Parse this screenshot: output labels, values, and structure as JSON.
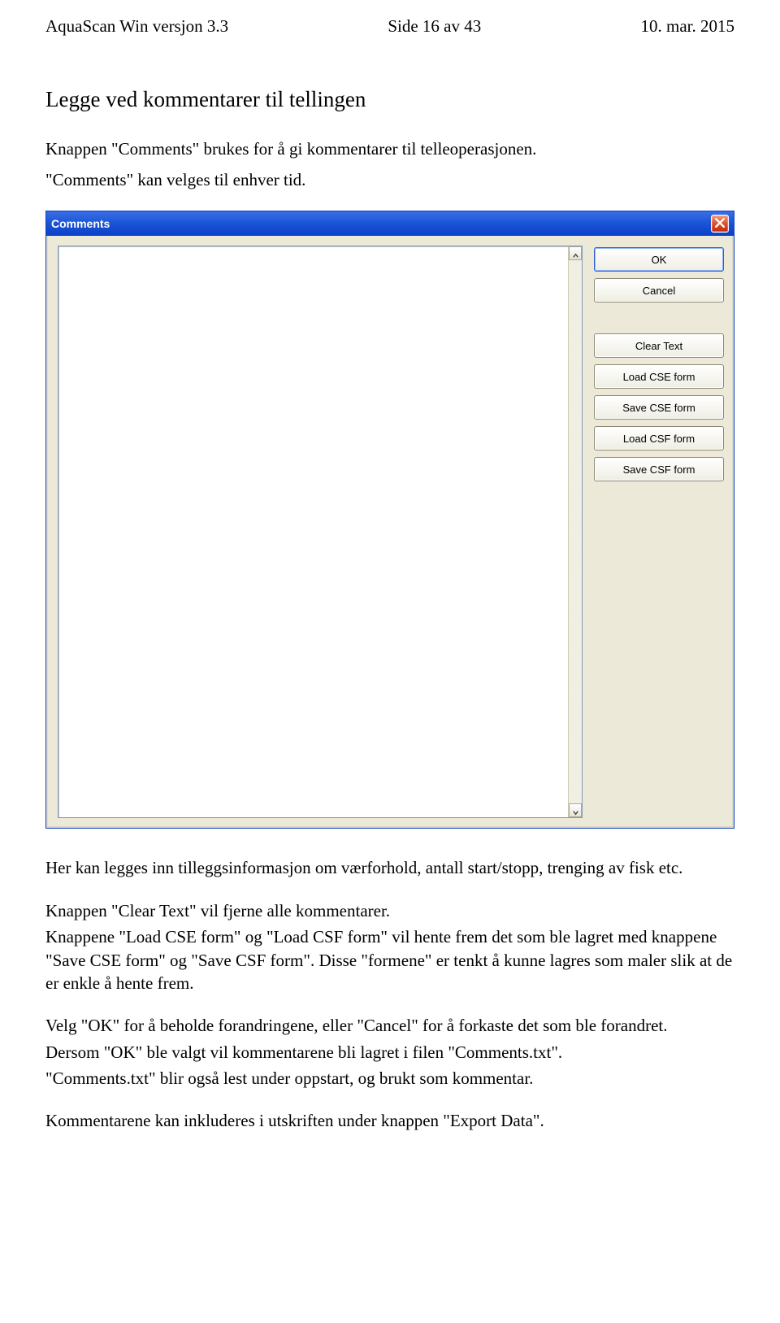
{
  "header": {
    "left": "AquaScan Win versjon 3.3",
    "center": "Side 16 av 43",
    "right": "10. mar. 2015"
  },
  "section_title": "Legge ved kommentarer til tellingen",
  "intro_p1": "Knappen \"Comments\" brukes for å gi kommentarer til telleoperasjonen.",
  "intro_p2": "\"Comments\" kan velges til enhver tid.",
  "window": {
    "title": "Comments",
    "buttons": {
      "ok": "OK",
      "cancel": "Cancel",
      "clear_text": "Clear Text",
      "load_cse": "Load CSE form",
      "save_cse": "Save CSE form",
      "load_csf": "Load CSF form",
      "save_csf": "Save CSF form"
    },
    "textarea_value": ""
  },
  "body": {
    "p1": "Her kan legges inn tilleggsinformasjon om værforhold, antall start/stopp, trenging av fisk etc.",
    "p2": "Knappen \"Clear Text\" vil fjerne alle kommentarer.",
    "p3": "Knappene \"Load CSE form\" og \"Load CSF form\" vil hente frem det som ble lagret med knappene \"Save CSE form\" og \"Save CSF form\". Disse \"formene\" er tenkt å kunne lagres som maler slik at de er enkle å hente frem.",
    "p4": "Velg \"OK\" for å beholde forandringene, eller \"Cancel\" for å forkaste det som ble forandret.",
    "p5": "Dersom \"OK\" ble valgt vil kommentarene bli lagret i filen \"Comments.txt\".",
    "p6": "\"Comments.txt\" blir også lest under oppstart, og brukt som kommentar.",
    "p7": "Kommentarene kan inkluderes i utskriften under knappen \"Export Data\"."
  }
}
